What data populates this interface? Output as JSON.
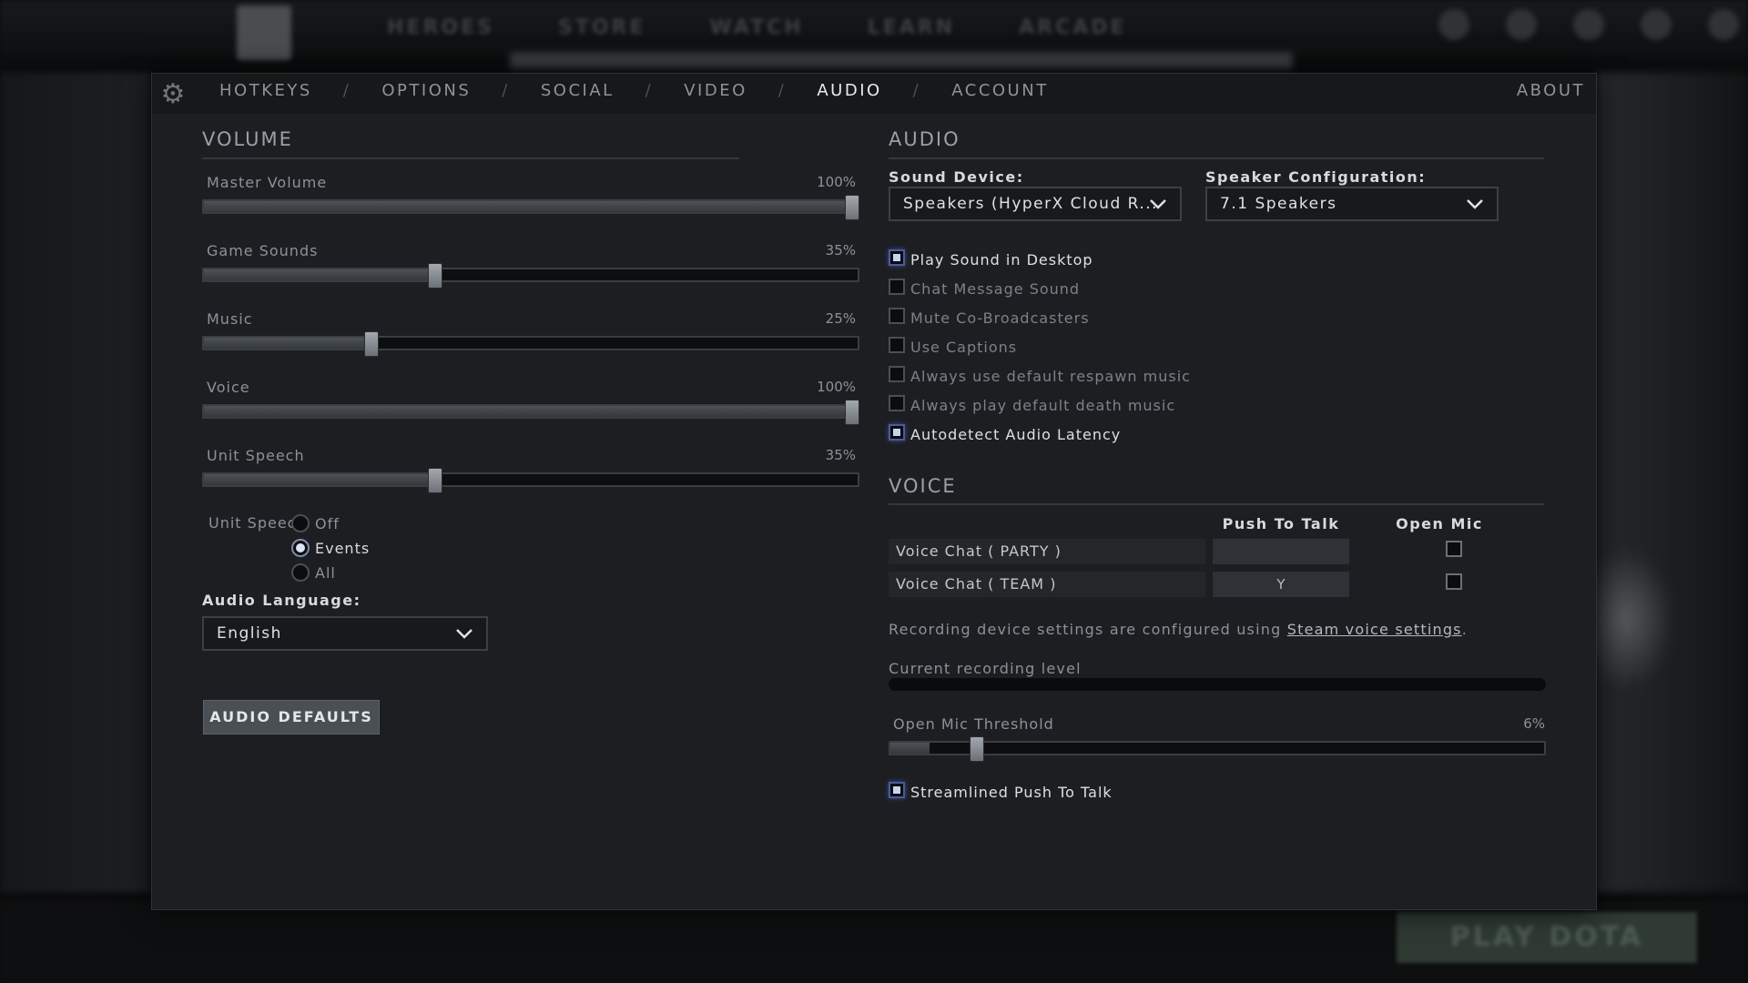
{
  "background": {
    "nav": [
      "HEROES",
      "STORE",
      "WATCH",
      "LEARN",
      "ARCADE"
    ],
    "play_button": "PLAY DOTA"
  },
  "tabs": [
    "HOTKEYS",
    "OPTIONS",
    "SOCIAL",
    "VIDEO",
    "AUDIO",
    "ACCOUNT"
  ],
  "active_tab": "AUDIO",
  "about_label": "ABOUT",
  "volume": {
    "title": "VOLUME",
    "sliders": [
      {
        "label": "Master Volume",
        "value_text": "100%",
        "value": 1.0
      },
      {
        "label": "Game Sounds",
        "value_text": "35%",
        "value": 0.35
      },
      {
        "label": "Music",
        "value_text": "25%",
        "value": 0.25
      },
      {
        "label": "Voice",
        "value_text": "100%",
        "value": 1.0
      },
      {
        "label": "Unit Speech",
        "value_text": "35%",
        "value": 0.35
      }
    ],
    "unit_speech": {
      "label": "Unit Speech",
      "options": [
        "Off",
        "Events",
        "All"
      ],
      "selected": "Events"
    },
    "audio_language": {
      "label": "Audio Language:",
      "value": "English"
    },
    "defaults_button": "AUDIO DEFAULTS"
  },
  "audio": {
    "title": "AUDIO",
    "sound_device": {
      "label": "Sound Device:",
      "value": "Speakers (HyperX Cloud R..."
    },
    "speaker_config": {
      "label": "Speaker Configuration:",
      "value": "7.1 Speakers"
    },
    "checkboxes": [
      {
        "label": "Play Sound in Desktop",
        "checked": true
      },
      {
        "label": "Chat Message Sound",
        "checked": false
      },
      {
        "label": "Mute Co-Broadcasters",
        "checked": false
      },
      {
        "label": "Use Captions",
        "checked": false
      },
      {
        "label": "Always use default respawn music",
        "checked": false
      },
      {
        "label": "Always play default death music",
        "checked": false
      },
      {
        "label": "Autodetect Audio Latency",
        "checked": true
      }
    ]
  },
  "voice": {
    "title": "VOICE",
    "col_push": "Push To Talk",
    "col_open": "Open Mic",
    "rows": [
      {
        "label": "Voice Chat ( PARTY )",
        "key": "",
        "open_mic": false
      },
      {
        "label": "Voice Chat ( TEAM )",
        "key": "Y",
        "open_mic": false
      }
    ],
    "note_prefix": "Recording device settings are configured using ",
    "note_link": "Steam voice settings",
    "note_suffix": ".",
    "recording_label": "Current recording level",
    "threshold": {
      "label": "Open Mic Threshold",
      "value_text": "6%",
      "value": 0.06
    },
    "streamlined": {
      "label": "Streamlined Push To Talk",
      "checked": true
    }
  },
  "colors": {
    "panel_bg": "#1c1e21",
    "active_text": "#e8eaec",
    "checkbox_accent": "#4c5a9c"
  }
}
